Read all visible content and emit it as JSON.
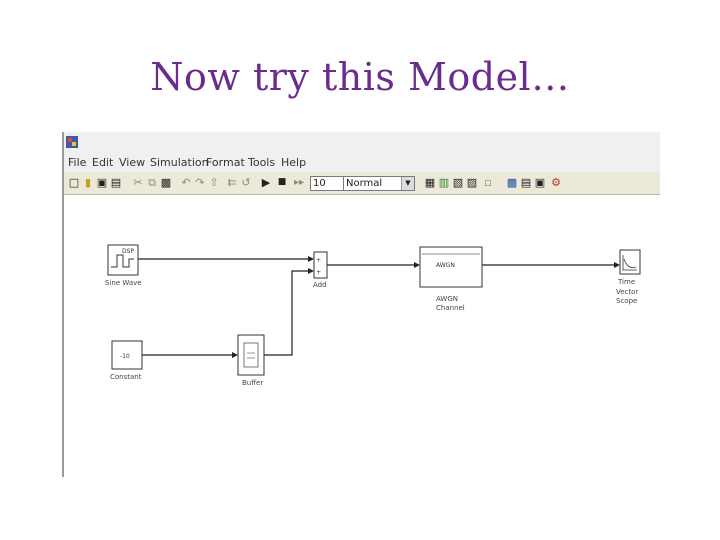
{
  "slide": {
    "title": "Now try this Model…"
  },
  "menu": [
    "File",
    "Edit",
    "View",
    "Simulation",
    "Format",
    "Tools",
    "Help"
  ],
  "toolbar": {
    "stop_time": "10",
    "sim_mode": "Normal"
  },
  "blocks": {
    "sine": {
      "label": "Sine Wave",
      "text": "DSP"
    },
    "add": {
      "label": "Add",
      "sign1": "+",
      "sign2": "+"
    },
    "awgn": {
      "text": "AWGN",
      "label1": "AWGN",
      "label2": "Channel"
    },
    "scope": {
      "text": "Time",
      "label1": "Vector",
      "label2": "Scope"
    },
    "constant": {
      "text": "-10",
      "label": "Constant"
    },
    "buffer": {
      "label": "Buffer"
    }
  }
}
